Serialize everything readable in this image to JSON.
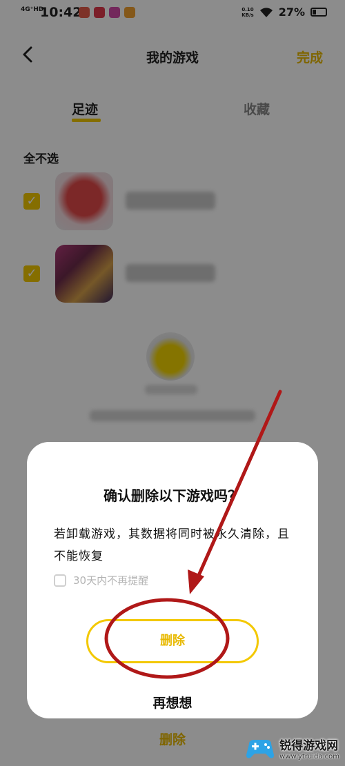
{
  "status_bar": {
    "network": "4G⁺HD",
    "time": "10:42",
    "speed_value": "0.10",
    "speed_unit": "KB/s",
    "battery": "27%"
  },
  "nav": {
    "back_icon": "chevron-left-icon",
    "title": "我的游戏",
    "done_label": "完成"
  },
  "tabs": {
    "footprint": "足迹",
    "favorites": "收藏"
  },
  "select_none_label": "全不选",
  "bottom_bar": {
    "delete_label": "删除"
  },
  "dialog": {
    "title": "确认删除以下游戏吗？",
    "body": "若卸载游戏，其数据将同时被永久清除，且不能恢复",
    "checkbox_label": "30天内不再提醒",
    "delete_label": "删除",
    "rethink_label": "再想想"
  },
  "watermark": {
    "name": "锐得游戏网",
    "url": "www.ytruida.com"
  },
  "colors": {
    "accent": "#f3c800",
    "accent_text": "#e8b900",
    "annotation": "#b01818"
  }
}
